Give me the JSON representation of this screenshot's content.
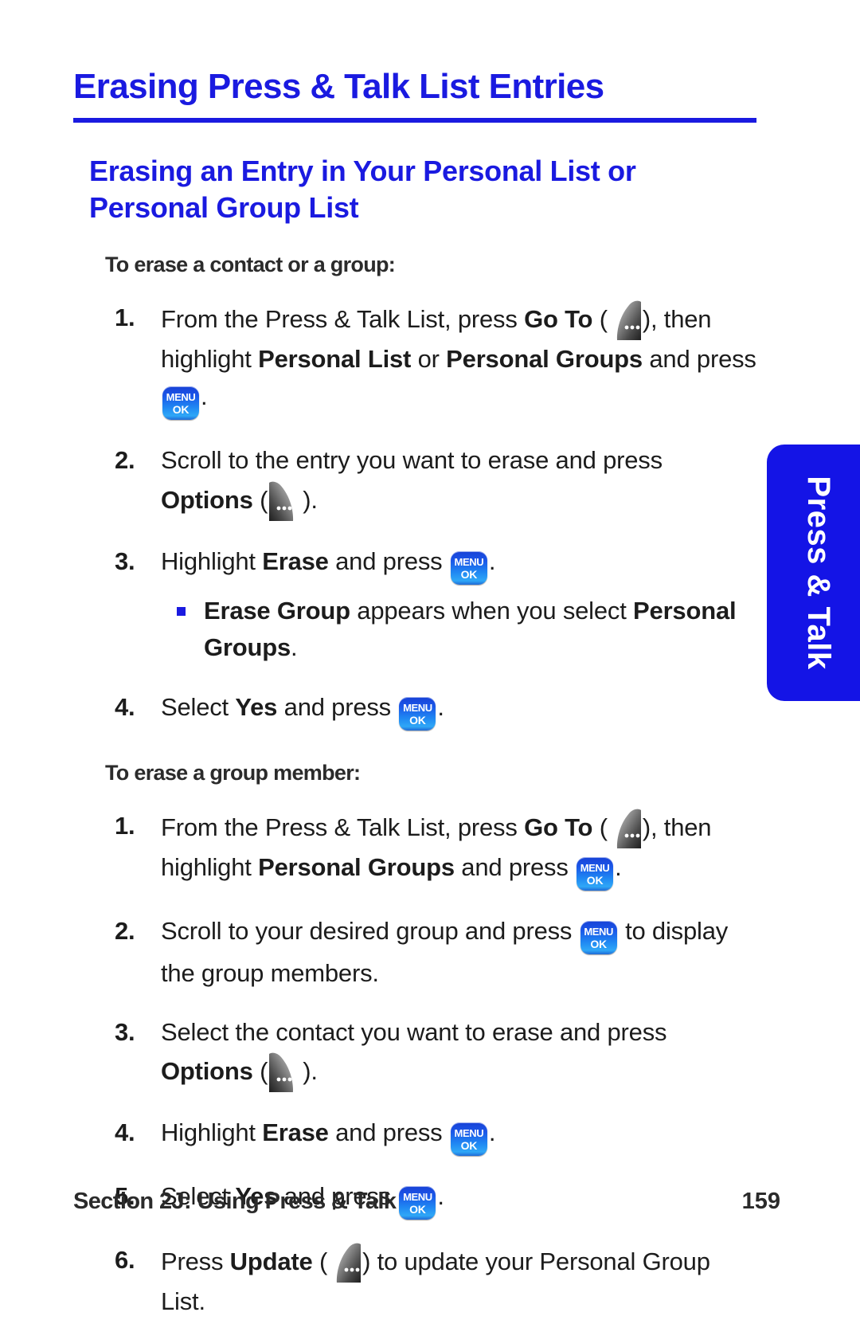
{
  "page": {
    "title": "Erasing Press & Talk List Entries",
    "section_heading": "Erasing an Entry in Your Personal List or Personal Group List"
  },
  "side_tab": {
    "label": "Press & Talk",
    "color": "#1414e6",
    "text_color": "#ffffff"
  },
  "colors": {
    "heading_blue": "#1a1ae0",
    "body_black": "#1c1c1c",
    "key_blue": "#1f86f2",
    "bullet_blue": "#1a1ae0"
  },
  "icons": {
    "menu_ok": {
      "line1": "MENU",
      "line2": "OK",
      "name": "menu-ok-key-icon"
    },
    "go_to": {
      "name": "go-to-softkey-icon"
    },
    "options": {
      "name": "options-softkey-icon"
    },
    "update": {
      "name": "update-softkey-icon"
    }
  },
  "procedure_1": {
    "lead_in": "To erase a contact or a group:",
    "steps": [
      {
        "num": "1.",
        "parts": [
          {
            "t": "text",
            "v": "From the Press & Talk List, press "
          },
          {
            "t": "bold",
            "v": "Go To"
          },
          {
            "t": "text",
            "v": " ("
          },
          {
            "t": "icon",
            "v": "go_to"
          },
          {
            "t": "text",
            "v": "), then highlight "
          },
          {
            "t": "bold",
            "v": "Personal List"
          },
          {
            "t": "text",
            "v": " or "
          },
          {
            "t": "bold",
            "v": "Personal Groups"
          },
          {
            "t": "text",
            "v": " and press "
          },
          {
            "t": "icon",
            "v": "menu_ok"
          },
          {
            "t": "text",
            "v": "."
          }
        ]
      },
      {
        "num": "2.",
        "parts": [
          {
            "t": "text",
            "v": "Scroll to the entry you want to erase and press "
          },
          {
            "t": "bold",
            "v": "Options"
          },
          {
            "t": "text",
            "v": " ("
          },
          {
            "t": "icon",
            "v": "options"
          },
          {
            "t": "text",
            "v": ")."
          }
        ]
      },
      {
        "num": "3.",
        "parts": [
          {
            "t": "text",
            "v": "Highlight "
          },
          {
            "t": "bold",
            "v": "Erase"
          },
          {
            "t": "text",
            "v": " and press "
          },
          {
            "t": "icon",
            "v": "menu_ok"
          },
          {
            "t": "text",
            "v": "."
          }
        ],
        "subitems": [
          {
            "parts": [
              {
                "t": "bold",
                "v": "Erase Group"
              },
              {
                "t": "text",
                "v": " appears when you select "
              },
              {
                "t": "bold",
                "v": "Personal Groups"
              },
              {
                "t": "text",
                "v": "."
              }
            ]
          }
        ]
      },
      {
        "num": "4.",
        "parts": [
          {
            "t": "text",
            "v": "Select "
          },
          {
            "t": "bold",
            "v": "Yes"
          },
          {
            "t": "text",
            "v": " and press "
          },
          {
            "t": "icon",
            "v": "menu_ok"
          },
          {
            "t": "text",
            "v": "."
          }
        ]
      }
    ]
  },
  "procedure_2": {
    "lead_in": "To erase a group member:",
    "steps": [
      {
        "num": "1.",
        "parts": [
          {
            "t": "text",
            "v": "From the Press & Talk List, press "
          },
          {
            "t": "bold",
            "v": "Go To"
          },
          {
            "t": "text",
            "v": " ("
          },
          {
            "t": "icon",
            "v": "go_to"
          },
          {
            "t": "text",
            "v": "), then highlight "
          },
          {
            "t": "bold",
            "v": "Personal Groups"
          },
          {
            "t": "text",
            "v": " and press "
          },
          {
            "t": "icon",
            "v": "menu_ok"
          },
          {
            "t": "text",
            "v": "."
          }
        ]
      },
      {
        "num": "2.",
        "parts": [
          {
            "t": "text",
            "v": "Scroll to your desired group and press "
          },
          {
            "t": "icon",
            "v": "menu_ok"
          },
          {
            "t": "text",
            "v": " to display the group members."
          }
        ]
      },
      {
        "num": "3.",
        "parts": [
          {
            "t": "text",
            "v": "Select the contact you want to erase and press "
          },
          {
            "t": "bold",
            "v": "Options"
          },
          {
            "t": "text",
            "v": " ("
          },
          {
            "t": "icon",
            "v": "options"
          },
          {
            "t": "text",
            "v": ")."
          }
        ]
      },
      {
        "num": "4.",
        "parts": [
          {
            "t": "text",
            "v": "Highlight "
          },
          {
            "t": "bold",
            "v": "Erase"
          },
          {
            "t": "text",
            "v": " and press "
          },
          {
            "t": "icon",
            "v": "menu_ok"
          },
          {
            "t": "text",
            "v": "."
          }
        ]
      },
      {
        "num": "5.",
        "parts": [
          {
            "t": "text",
            "v": "Select "
          },
          {
            "t": "bold",
            "v": "Yes"
          },
          {
            "t": "text",
            "v": " and press "
          },
          {
            "t": "icon",
            "v": "menu_ok"
          },
          {
            "t": "text",
            "v": "."
          }
        ]
      },
      {
        "num": "6.",
        "parts": [
          {
            "t": "text",
            "v": "Press "
          },
          {
            "t": "bold",
            "v": "Update"
          },
          {
            "t": "text",
            "v": " ("
          },
          {
            "t": "icon",
            "v": "update"
          },
          {
            "t": "text",
            "v": ") to update your Personal Group List."
          }
        ]
      }
    ]
  },
  "footer": {
    "section": "Section 2J: Using Press & Talk",
    "page_number": "159"
  }
}
